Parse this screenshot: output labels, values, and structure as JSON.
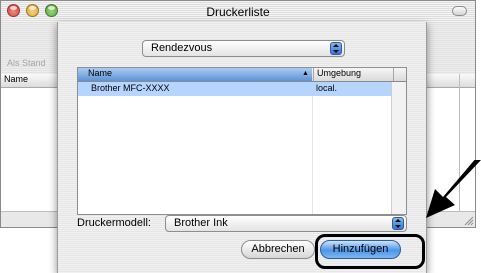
{
  "window": {
    "title": "Druckerliste",
    "ghost_label": "Als Stand",
    "column_name": "Name"
  },
  "sheet": {
    "popup_value": "Rendezvous",
    "list": {
      "headers": [
        "Name",
        "Umgebung"
      ],
      "rows": [
        {
          "name": "Brother MFC-XXXX",
          "umgebung": "local."
        }
      ]
    },
    "model_label": "Druckermodell:",
    "model_value": "Brother Ink",
    "cancel_label": "Abbrechen",
    "add_label": "Hinzufügen"
  },
  "colors": {
    "selection": "#b5d5ff",
    "accent": "#4d95e8",
    "close": "#e0524a",
    "minimize": "#e8b23a",
    "zoom": "#62b743"
  },
  "icons": [
    "close-icon",
    "minimize-icon",
    "zoom-icon",
    "toolbar-toggle-icon",
    "popup-arrows-icon",
    "sort-arrow-icon",
    "resize-grip-icon",
    "pointer-arrow-icon"
  ]
}
